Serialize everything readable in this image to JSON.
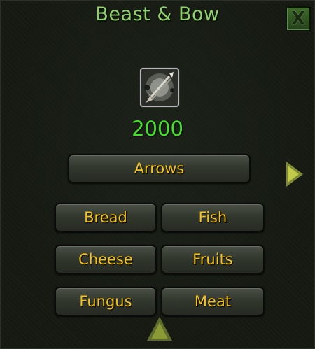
{
  "window": {
    "title": "Beast & Bow",
    "close_label": "X"
  },
  "item": {
    "icon": "arrow-icon",
    "count": "2000"
  },
  "main_button": {
    "label": "Arrows"
  },
  "food_buttons": [
    {
      "label": "Bread"
    },
    {
      "label": "Fish"
    },
    {
      "label": "Cheese"
    },
    {
      "label": "Fruits"
    },
    {
      "label": "Fungus"
    },
    {
      "label": "Meat"
    }
  ],
  "colors": {
    "title": "#8fd16a",
    "count": "#44e02a",
    "button_text": "#f3c21c",
    "close_button": "#3f6a2c"
  }
}
